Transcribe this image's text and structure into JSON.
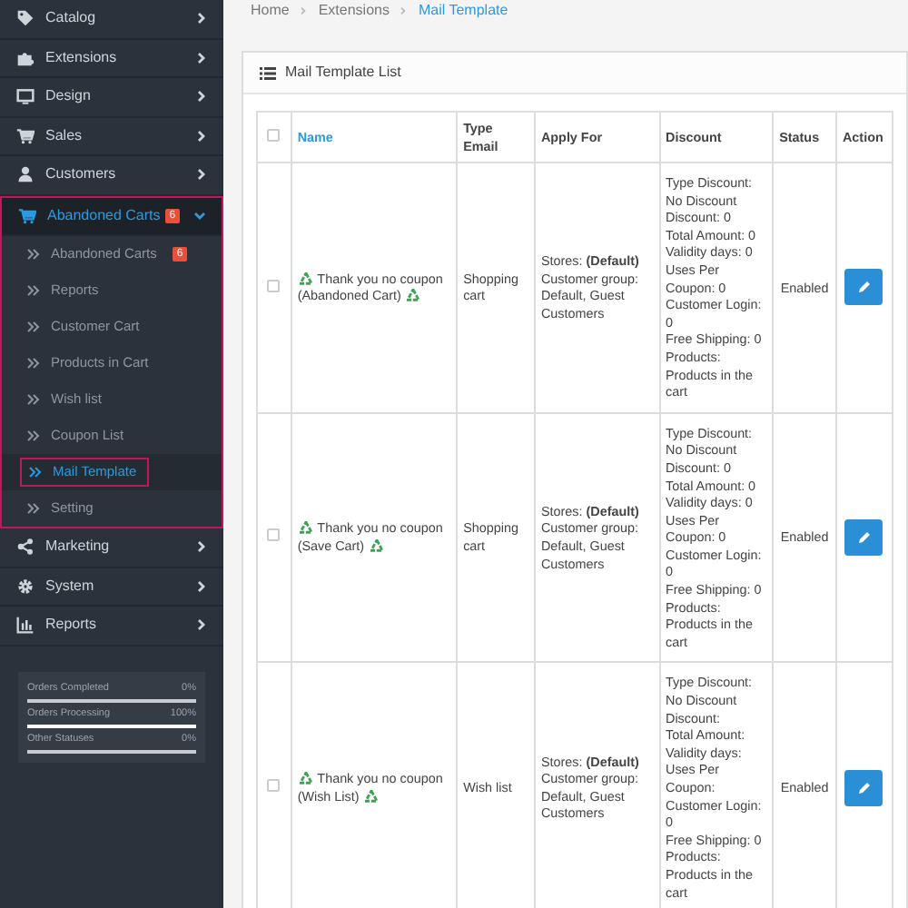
{
  "sidebar": {
    "items": [
      {
        "label": "Catalog",
        "expanded": false
      },
      {
        "label": "Extensions",
        "expanded": false
      },
      {
        "label": "Design",
        "expanded": false
      },
      {
        "label": "Sales",
        "expanded": false
      },
      {
        "label": "Customers",
        "expanded": false
      },
      {
        "label": "Abandoned Carts",
        "badge": "6",
        "expanded": true,
        "selected": true,
        "children": [
          {
            "label": "Abandoned Carts",
            "badge": "6",
            "selected": false
          },
          {
            "label": "Reports",
            "selected": false
          },
          {
            "label": "Customer Cart",
            "selected": false
          },
          {
            "label": "Products in Cart",
            "selected": false
          },
          {
            "label": "Wish list",
            "selected": false
          },
          {
            "label": "Coupon List",
            "selected": false
          },
          {
            "label": "Mail Template",
            "selected": true
          },
          {
            "label": "Setting",
            "selected": false
          }
        ]
      },
      {
        "label": "Marketing",
        "expanded": false
      },
      {
        "label": "System",
        "expanded": false
      },
      {
        "label": "Reports",
        "expanded": false
      }
    ],
    "stats": [
      {
        "label": "Orders Completed",
        "reading": "0%",
        "level": 0
      },
      {
        "label": "Orders Processing",
        "reading": "100%",
        "level": 1
      },
      {
        "label": "Other Statuses",
        "reading": "0%",
        "level": 0
      }
    ]
  },
  "breadcrumb": [
    {
      "label": "Home"
    },
    {
      "label": "Extensions"
    },
    {
      "label": "Mail Template"
    }
  ],
  "panel": {
    "title": "Mail Template List",
    "table": {
      "all_checked": false,
      "columns": [
        "Name",
        "Type Email",
        "Apply For",
        "Discount",
        "Status",
        "Action"
      ],
      "rows": [
        {
          "checked": false,
          "name": "Thank you no coupon (Abandoned Cart)",
          "type_email": "Shopping cart",
          "apply_for": [
            "Stores: **(Default)**",
            "Customer group: Default, Guest Customers"
          ],
          "discount": [
            "Type Discount: No Discount",
            "Discount: 0",
            "Total Amount: 0",
            "Validity days: 0",
            "Uses Per Coupon: 0",
            "Customer Login: 0",
            "Free Shipping: 0",
            "Products: Products in the cart"
          ],
          "status": "Enabled"
        },
        {
          "checked": false,
          "name": "Thank you no coupon (Save Cart)",
          "type_email": "Shopping cart",
          "apply_for": [
            "Stores: **(Default)**",
            "Customer group: Default, Guest Customers"
          ],
          "discount": [
            "Type Discount: No Discount",
            "Discount: 0",
            "Total Amount: 0",
            "Validity days: 0",
            "Uses Per Coupon: 0",
            "Customer Login: 0",
            "Free Shipping: 0",
            "Products: Products in the cart"
          ],
          "status": "Enabled"
        },
        {
          "checked": false,
          "name": "Thank you no coupon (Wish List)",
          "type_email": "Wish list",
          "apply_for": [
            "Stores: **(Default)**",
            "Customer group: Default, Guest Customers"
          ],
          "discount": [
            "Type Discount: No Discount",
            "Discount:",
            "Total Amount:",
            "Validity days:",
            "Uses Per Coupon:",
            "Customer Login: 0",
            "Free Shipping: 0",
            "Products: Products in the cart"
          ],
          "status": "Enabled"
        }
      ]
    }
  }
}
